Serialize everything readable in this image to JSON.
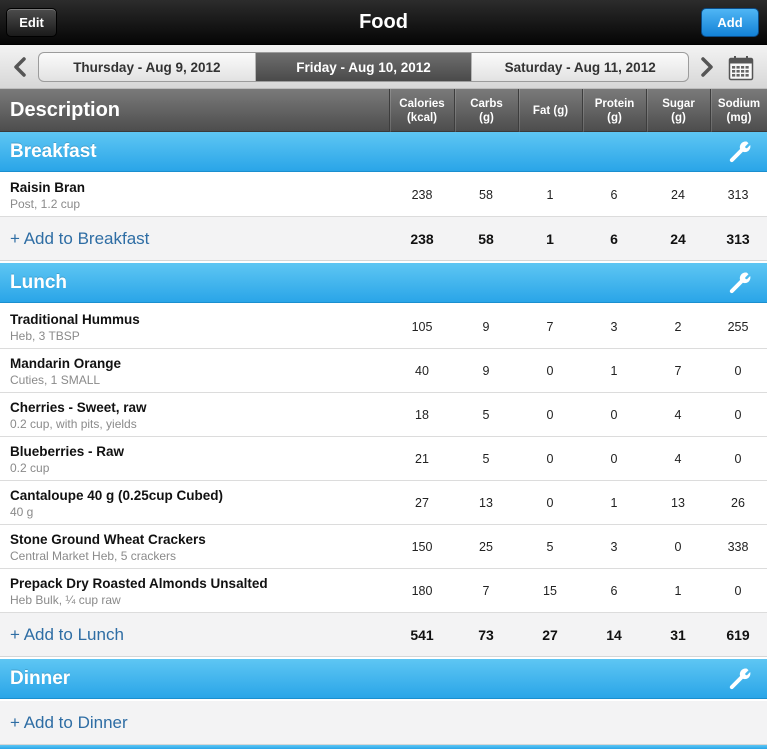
{
  "header": {
    "edit_label": "Edit",
    "title": "Food",
    "add_label": "Add"
  },
  "dates": {
    "prev": "Thursday - Aug 9, 2012",
    "current": "Friday - Aug 10, 2012",
    "next": "Saturday - Aug 11, 2012"
  },
  "columns": {
    "description": "Description",
    "calories": "Calories\n(kcal)",
    "carbs": "Carbs\n(g)",
    "fat": "Fat (g)",
    "protein": "Protein\n(g)",
    "sugar": "Sugar\n(g)",
    "sodium": "Sodium\n(mg)"
  },
  "breakfast": {
    "name": "Breakfast",
    "items": [
      {
        "name": "Raisin Bran",
        "sub": "Post, 1.2 cup",
        "calories": "238",
        "carbs": "58",
        "fat": "1",
        "protein": "6",
        "sugar": "24",
        "sodium": "313"
      }
    ],
    "add_label": "+ Add to Breakfast",
    "totals": {
      "calories": "238",
      "carbs": "58",
      "fat": "1",
      "protein": "6",
      "sugar": "24",
      "sodium": "313"
    }
  },
  "lunch": {
    "name": "Lunch",
    "items": [
      {
        "name": "Traditional Hummus",
        "sub": "Heb, 3 TBSP",
        "calories": "105",
        "carbs": "9",
        "fat": "7",
        "protein": "3",
        "sugar": "2",
        "sodium": "255"
      },
      {
        "name": "Mandarin Orange",
        "sub": "Cuties, 1 SMALL",
        "calories": "40",
        "carbs": "9",
        "fat": "0",
        "protein": "1",
        "sugar": "7",
        "sodium": "0"
      },
      {
        "name": "Cherries - Sweet, raw",
        "sub": "0.2 cup, with pits, yields",
        "calories": "18",
        "carbs": "5",
        "fat": "0",
        "protein": "0",
        "sugar": "4",
        "sodium": "0"
      },
      {
        "name": "Blueberries - Raw",
        "sub": "0.2 cup",
        "calories": "21",
        "carbs": "5",
        "fat": "0",
        "protein": "0",
        "sugar": "4",
        "sodium": "0"
      },
      {
        "name": "Cantaloupe 40 g (0.25cup Cubed)",
        "sub": "40 g",
        "calories": "27",
        "carbs": "13",
        "fat": "0",
        "protein": "1",
        "sugar": "13",
        "sodium": "26"
      },
      {
        "name": "Stone Ground Wheat Crackers",
        "sub": "Central Market Heb, 5 crackers",
        "calories": "150",
        "carbs": "25",
        "fat": "5",
        "protein": "3",
        "sugar": "0",
        "sodium": "338"
      },
      {
        "name": "Prepack Dry Roasted Almonds Unsalted",
        "sub": "Heb Bulk, ¼ cup raw",
        "calories": "180",
        "carbs": "7",
        "fat": "15",
        "protein": "6",
        "sugar": "1",
        "sodium": "0"
      }
    ],
    "add_label": "+ Add to Lunch",
    "totals": {
      "calories": "541",
      "carbs": "73",
      "fat": "27",
      "protein": "14",
      "sugar": "31",
      "sodium": "619"
    }
  },
  "dinner": {
    "name": "Dinner",
    "add_label": "+ Add to Dinner"
  }
}
